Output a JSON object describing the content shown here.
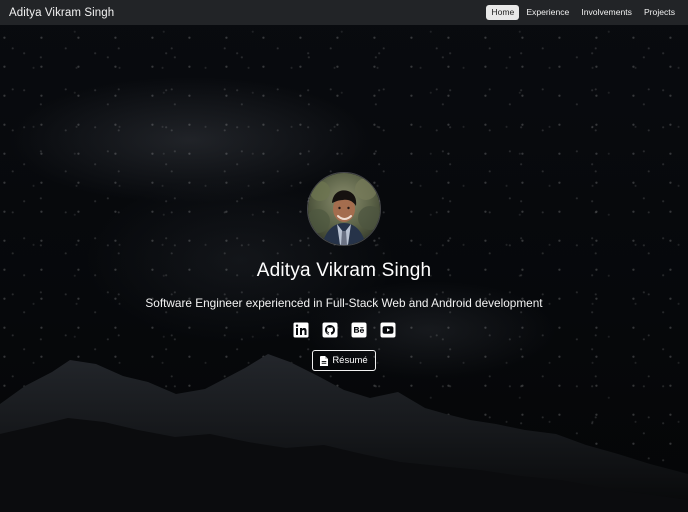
{
  "navbar": {
    "brand": "Aditya Vikram Singh",
    "links": [
      {
        "label": "Home",
        "active": true
      },
      {
        "label": "Experience",
        "active": false
      },
      {
        "label": "Involvements",
        "active": false
      },
      {
        "label": "Projects",
        "active": false
      }
    ]
  },
  "hero": {
    "name": "Aditya Vikram Singh",
    "tagline": "Software Engineer experienced in Full-Stack Web and Android development",
    "socials": [
      {
        "icon": "linkedin-icon"
      },
      {
        "icon": "github-icon"
      },
      {
        "icon": "behance-icon"
      },
      {
        "icon": "youtube-icon"
      }
    ],
    "resume_label": "Résumé"
  },
  "colors": {
    "navbar_bg": "#222427",
    "background": "#06080b",
    "text": "#ffffff",
    "active_nav_bg": "#e8e8e8"
  }
}
